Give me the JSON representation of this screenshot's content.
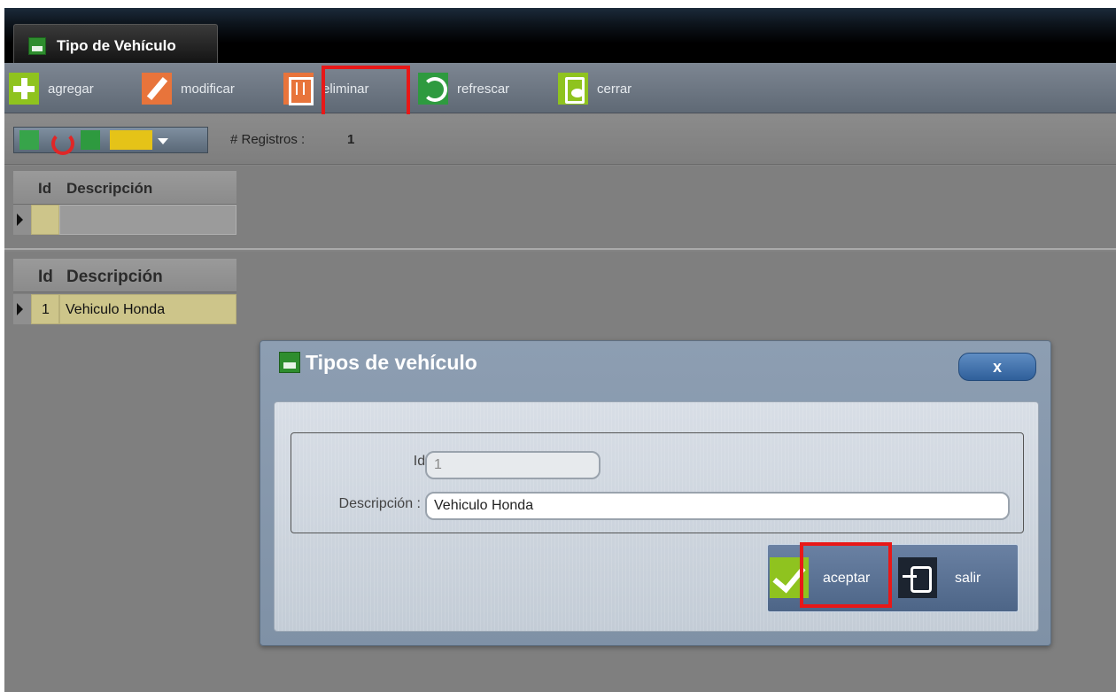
{
  "window": {
    "tab_title": "Tipo de Vehículo"
  },
  "toolbar": {
    "add_label": "agregar",
    "edit_label": "modificar",
    "delete_label": "eliminar",
    "refresh_label": "refrescar",
    "close_label": "cerrar"
  },
  "subbar": {
    "records_label": "# Registros :",
    "records_count": "1"
  },
  "grid_top": {
    "col_id": "Id",
    "col_desc": "Descripción"
  },
  "grid_main": {
    "col_id": "Id",
    "col_desc": "Descripción",
    "rows": [
      {
        "id": "1",
        "descripcion": "Vehiculo Honda"
      }
    ]
  },
  "modal": {
    "title": "Tipos de vehículo",
    "close_label": "x",
    "id_label": "Id :",
    "id_value": "1",
    "desc_label": "Descripción :",
    "desc_value": "Vehiculo Honda",
    "accept_label": "aceptar",
    "exit_label": "salir"
  },
  "colors": {
    "highlight": "#e81818",
    "accent_green": "#8fc31f",
    "accent_orange": "#e8743b",
    "row_selected": "#cdc58a"
  }
}
